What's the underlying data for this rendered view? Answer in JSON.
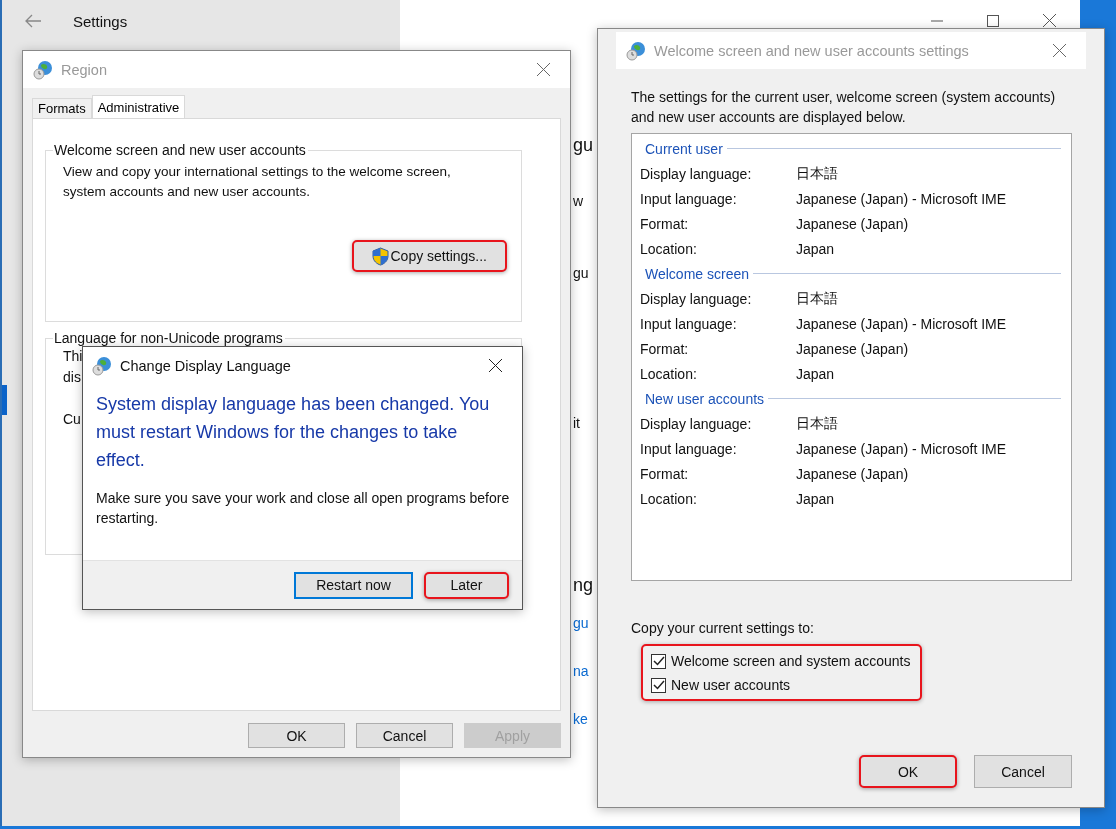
{
  "settings": {
    "title": "Settings",
    "fragments": [
      {
        "text": "gu",
        "kind": "heading"
      },
      {
        "text": "w",
        "kind": "text"
      },
      {
        "text": "gu",
        "kind": "text"
      },
      {
        "text": "it",
        "kind": "text"
      },
      {
        "text": "ng",
        "kind": "heading"
      },
      {
        "text": "gu",
        "kind": "link"
      },
      {
        "text": "na",
        "kind": "link"
      },
      {
        "text": "ke",
        "kind": "link"
      }
    ]
  },
  "region": {
    "title": "Region",
    "tabs": [
      {
        "label": "Formats",
        "selected": false
      },
      {
        "label": "Administrative",
        "selected": true
      }
    ],
    "welcome_group": {
      "title": "Welcome screen and new user accounts",
      "text": "View and copy your international settings to the welcome screen, system accounts and new user accounts.",
      "button": {
        "label": "Copy settings...",
        "highlighted": true
      }
    },
    "unicode_group": {
      "title": "Language for non-Unicode programs",
      "lines": [
        "Thi",
        "dis",
        "Cu"
      ]
    },
    "buttons": [
      {
        "label": "OK",
        "disabled": false,
        "highlighted": false
      },
      {
        "label": "Cancel",
        "disabled": false,
        "highlighted": false
      },
      {
        "label": "Apply",
        "disabled": true,
        "highlighted": false
      }
    ]
  },
  "change_dialog": {
    "title": "Change Display Language",
    "heading": "System display language has been changed. You must restart Windows for the changes to take effect.",
    "text": "Make sure you save your work and close all open programs before restarting.",
    "buttons": [
      {
        "label": "Restart now",
        "default": true,
        "highlighted": false
      },
      {
        "label": "Later",
        "default": false,
        "highlighted": true
      }
    ]
  },
  "copy_dialog": {
    "title": "Welcome screen and new user accounts settings",
    "intro": "The settings for the current user, welcome screen (system accounts) and new user accounts are displayed below.",
    "sections": [
      {
        "title": "Current user",
        "rows": [
          {
            "label": "Display language:",
            "value": "日本語"
          },
          {
            "label": "Input language:",
            "value": "Japanese (Japan) - Microsoft IME"
          },
          {
            "label": "Format:",
            "value": "Japanese (Japan)"
          },
          {
            "label": "Location:",
            "value": "Japan"
          }
        ]
      },
      {
        "title": "Welcome screen",
        "rows": [
          {
            "label": "Display language:",
            "value": "日本語"
          },
          {
            "label": "Input language:",
            "value": "Japanese (Japan) - Microsoft IME"
          },
          {
            "label": "Format:",
            "value": "Japanese (Japan)"
          },
          {
            "label": "Location:",
            "value": "Japan"
          }
        ]
      },
      {
        "title": "New user accounts",
        "rows": [
          {
            "label": "Display language:",
            "value": "日本語"
          },
          {
            "label": "Input language:",
            "value": "Japanese (Japan) - Microsoft IME"
          },
          {
            "label": "Format:",
            "value": "Japanese (Japan)"
          },
          {
            "label": "Location:",
            "value": "Japan"
          }
        ]
      }
    ],
    "copy_to": {
      "label": "Copy your current settings to:",
      "highlighted": true,
      "options": [
        {
          "label": "Welcome screen and system accounts",
          "checked": true
        },
        {
          "label": "New user accounts",
          "checked": true
        }
      ]
    },
    "buttons": [
      {
        "label": "OK",
        "highlighted": true
      },
      {
        "label": "Cancel",
        "highlighted": false
      }
    ]
  }
}
